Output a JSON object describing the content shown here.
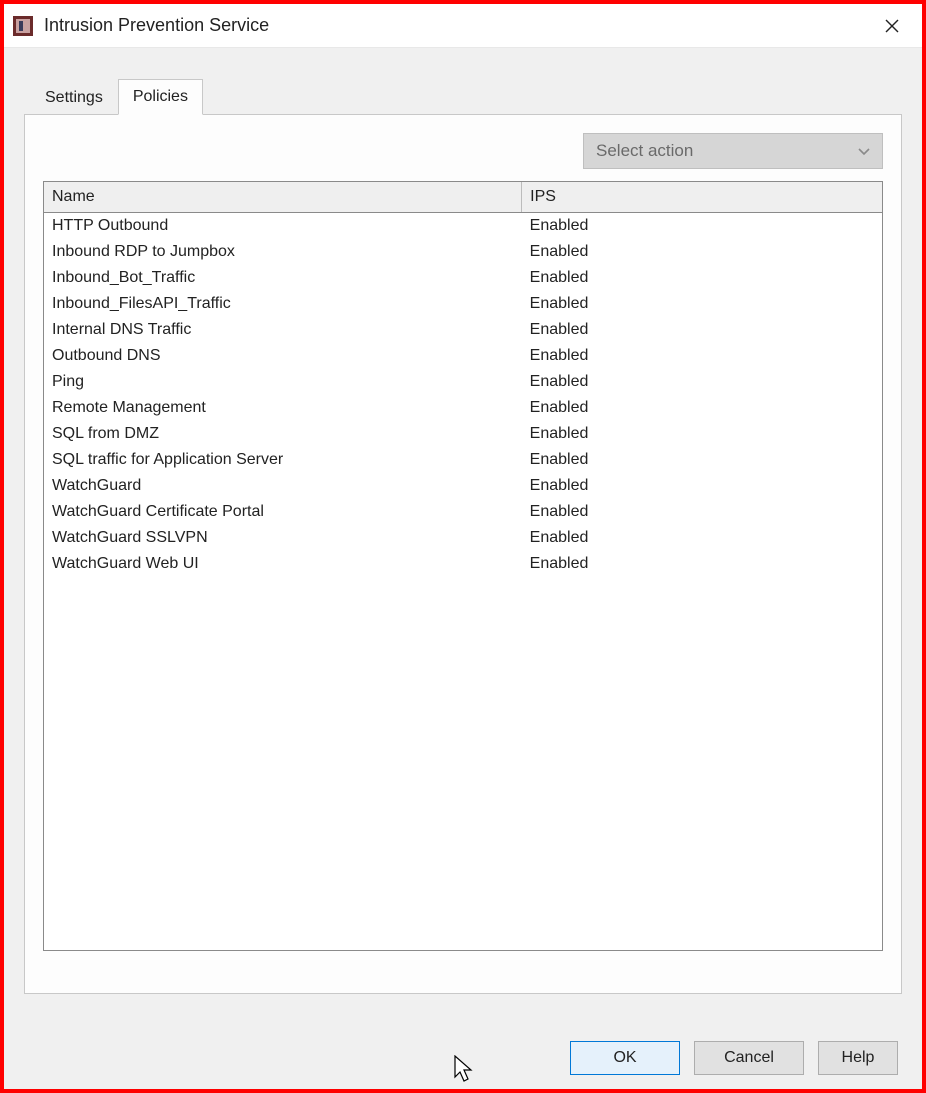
{
  "window": {
    "title": "Intrusion Prevention Service"
  },
  "tabs": {
    "settings": "Settings",
    "policies": "Policies"
  },
  "action_dropdown": {
    "label": "Select action"
  },
  "table": {
    "headers": {
      "name": "Name",
      "ips": "IPS"
    },
    "rows": [
      {
        "name": "HTTP Outbound",
        "ips": "Enabled"
      },
      {
        "name": "Inbound RDP to Jumpbox",
        "ips": "Enabled"
      },
      {
        "name": "Inbound_Bot_Traffic",
        "ips": "Enabled"
      },
      {
        "name": "Inbound_FilesAPI_Traffic",
        "ips": "Enabled"
      },
      {
        "name": "Internal DNS Traffic",
        "ips": "Enabled"
      },
      {
        "name": "Outbound DNS",
        "ips": "Enabled"
      },
      {
        "name": "Ping",
        "ips": "Enabled"
      },
      {
        "name": "Remote Management",
        "ips": "Enabled"
      },
      {
        "name": "SQL from DMZ",
        "ips": "Enabled"
      },
      {
        "name": "SQL traffic for Application Server",
        "ips": "Enabled"
      },
      {
        "name": "WatchGuard",
        "ips": "Enabled"
      },
      {
        "name": "WatchGuard Certificate Portal",
        "ips": "Enabled"
      },
      {
        "name": "WatchGuard SSLVPN",
        "ips": "Enabled"
      },
      {
        "name": "WatchGuard Web UI",
        "ips": "Enabled"
      }
    ]
  },
  "buttons": {
    "ok": "OK",
    "cancel": "Cancel",
    "help": "Help"
  }
}
